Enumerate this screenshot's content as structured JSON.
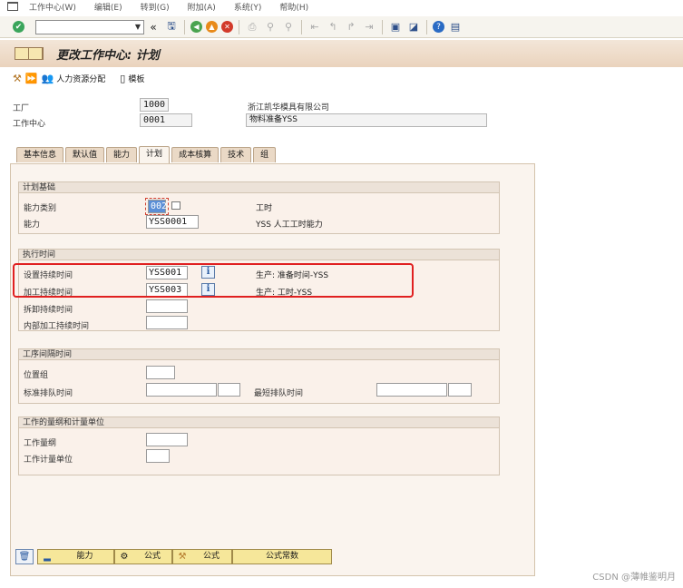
{
  "menu": {
    "items": [
      "工作中心(W)",
      "编辑(E)",
      "转到(G)",
      "附加(A)",
      "系统(Y)",
      "帮助(H)"
    ]
  },
  "toolbar": {
    "command_value": ""
  },
  "header": {
    "title": "更改工作中心: 计划"
  },
  "app_toolbar": {
    "hr_label": "人力资源分配",
    "template_label": "模板"
  },
  "fields": {
    "plant_label": "工厂",
    "plant_value": "1000",
    "plant_desc": "浙江凯华模具有限公司",
    "wc_label": "工作中心",
    "wc_value": "0001",
    "wc_desc": "物料准备YSS"
  },
  "tabs": [
    "基本信息",
    "默认值",
    "能力",
    "计划",
    "成本核算",
    "技术",
    "组"
  ],
  "groups": {
    "basis": {
      "title": "计划基础",
      "cap_cat_label": "能力类别",
      "cap_cat_value": "002",
      "cap_cat_desc": "工时",
      "capacity_label": "能力",
      "capacity_value": "YSS0001",
      "capacity_desc": "YSS 人工工时能力"
    },
    "exec": {
      "title": "执行时间",
      "setup_label": "设置持续时间",
      "setup_value": "YSS001",
      "setup_desc": "生产: 准备时间-YSS",
      "proc_label": "加工持续时间",
      "proc_value": "YSS003",
      "proc_desc": "生产: 工时-YSS",
      "teardown_label": "拆卸持续时间",
      "internal_label": "内部加工持续时间"
    },
    "interop": {
      "title": "工序间隔时间",
      "loc_label": "位置组",
      "std_queue_label": "标准排队时间",
      "min_queue_label": "最短排队时间"
    },
    "work": {
      "title": "工作的量纲和计量单位",
      "dim_label": "工作量纲",
      "unit_label": "工作计量单位"
    }
  },
  "bottom": {
    "capacity_btn": "能力",
    "formula1_btn": "公式",
    "formula2_btn": "公式",
    "constants_btn": "公式常数"
  },
  "watermark": "CSDN @薄帷鉴明月"
}
